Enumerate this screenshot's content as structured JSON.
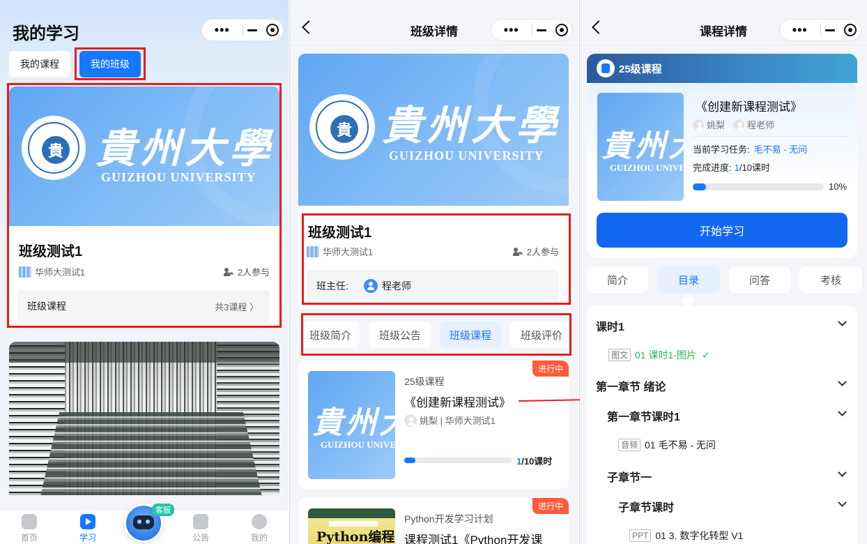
{
  "capsule": {
    "dots": "•••"
  },
  "screen1": {
    "title": "我的学习",
    "tabs": [
      "我的课程",
      "我的班级"
    ],
    "banner": {
      "calligraphy": "貴州大學",
      "english": "GUIZHOU UNIVERSITY"
    },
    "class_card": {
      "title": "班级测试1",
      "org": "华师大测试1",
      "participants": "2人参与",
      "course_row_label": "班级课程",
      "course_row_count": "共3课程 〉"
    },
    "bottom_nav": [
      "首页",
      "学习",
      "公告",
      "我的"
    ],
    "service_badge": "客服"
  },
  "screen2": {
    "title": "班级详情",
    "class_title": "班级测试1",
    "org": "华师大测试1",
    "participants": "2人参与",
    "head_teacher_label": "班主任:",
    "head_teacher_name": "程老师",
    "tabs": [
      "班级简介",
      "班级公告",
      "班级课程",
      "班级评价"
    ],
    "courses": [
      {
        "status": "进行中",
        "category": "25级课程",
        "title": "《创建新课程测试》",
        "meta": "姚梨 | 华师大测试1",
        "progress_fraction": 0.1,
        "progress_current": "1",
        "progress_total": "/10课时"
      },
      {
        "status": "进行中",
        "category": "Python开发学习计划",
        "title": "课程测试1《Python开发课",
        "book_title": "Python编程"
      }
    ]
  },
  "screen3": {
    "title": "课程详情",
    "card_header": "25级课程",
    "course_title": "《创建新课程测试》",
    "teacher1": "姚梨",
    "teacher2": "程老师",
    "current_task_label": "当前学习任务:",
    "current_task_value": "毛不易 - 无问",
    "progress_label": "完成进度:",
    "progress_current": "1",
    "progress_total": "/10课时",
    "progress_percent": "10%",
    "progress_fraction": 0.1,
    "start_button": "开始学习",
    "tabs": [
      "简介",
      "目录",
      "问答",
      "考核"
    ],
    "catalog": [
      {
        "label": "课时1",
        "level": 0
      },
      {
        "tag": "图文",
        "label": "01 课时1-图片",
        "check": "✓",
        "level": "lesson-done"
      },
      {
        "label": "第一章节 绪论",
        "level": 0
      },
      {
        "label": "第一章节课时1",
        "level": 1
      },
      {
        "tag": "音频",
        "label": "01 毛不易 - 无问",
        "level": "lesson"
      },
      {
        "label": "子章节一",
        "level": 1
      },
      {
        "label": "子章节课时",
        "level": 2
      },
      {
        "tag": "PPT",
        "label": "01 3. 数字化转型 V1",
        "level": "lesson"
      }
    ]
  },
  "colors": {
    "accent": "#1677ff",
    "highlight": "#e81c1c",
    "running": "#ff5a3c",
    "done": "#2fb45a"
  }
}
